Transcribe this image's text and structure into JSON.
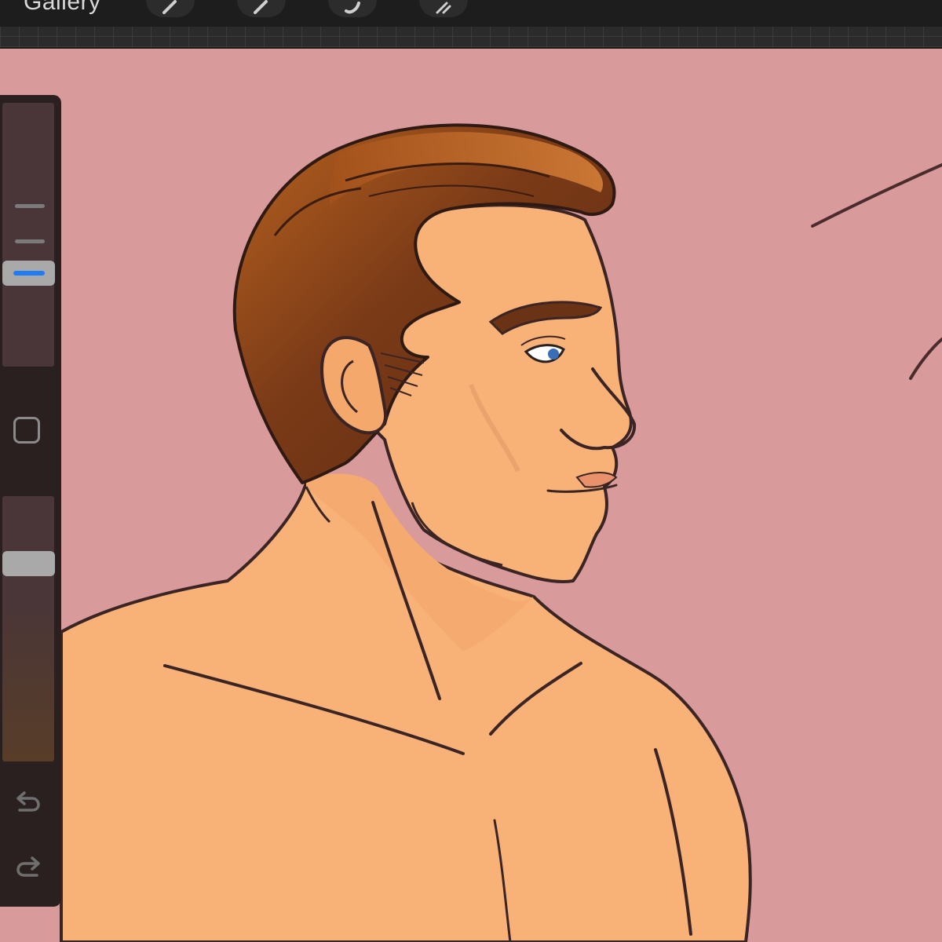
{
  "toolbar": {
    "gallery_label": "Gallery",
    "tools": [
      {
        "name": "brush",
        "icon": "brush-icon"
      },
      {
        "name": "smudge",
        "icon": "smudge-icon"
      },
      {
        "name": "eraser",
        "icon": "eraser-icon"
      },
      {
        "name": "layers",
        "icon": "layers-icon"
      }
    ]
  },
  "sidebar": {
    "brush_size_icon": "brush-size-slider",
    "modify_icon": "square-icon",
    "opacity_icon": "opacity-slider",
    "undo_icon": "undo-icon",
    "redo_icon": "redo-icon",
    "accent_color": "#1f7cf5"
  },
  "canvas": {
    "background_color": "#d99a9b",
    "skin_color": "#f8b176",
    "hair_color": "#7a3a17",
    "line_color": "#3a2424"
  }
}
